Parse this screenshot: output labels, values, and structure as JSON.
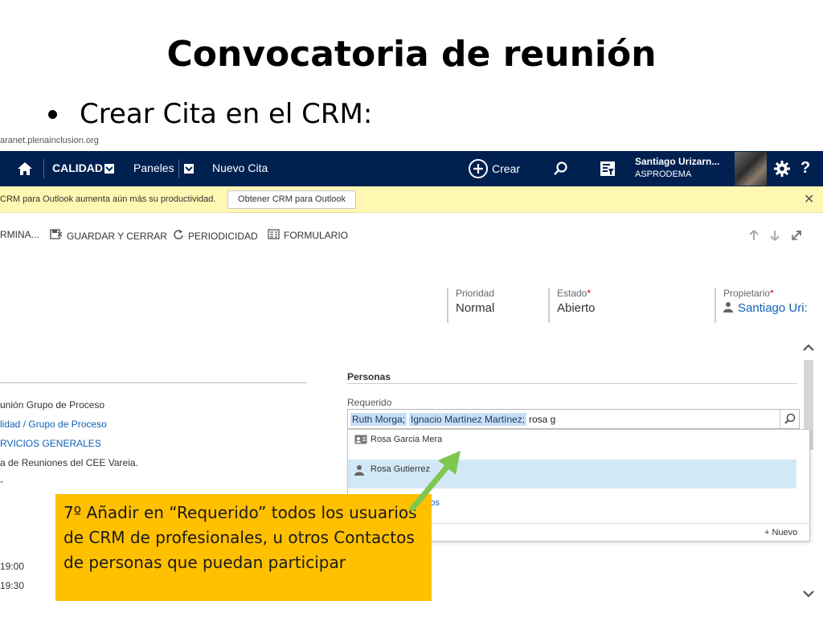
{
  "slide": {
    "title": "Convocatoria de reunión",
    "bullet": "Crear Cita en el CRM:"
  },
  "browser": {
    "url_fragment": "aranet.plenainclusion.org"
  },
  "topbar": {
    "home_icon": "home-icon",
    "area_label": "CALIDAD",
    "panels_label": "Paneles",
    "page_label": "Nuevo Cita",
    "create_label": "Crear",
    "user_name": "Santiago Urizarn...",
    "user_org": "ASPRODEMA",
    "help_label": "?",
    "colors": {
      "bar": "#002050",
      "text": "#ffffff"
    }
  },
  "notice": {
    "text": "CRM para Outlook aumenta aún más su productividad.",
    "button_label": "Obtener CRM para Outlook",
    "close_label": "✕",
    "colors": {
      "background": "#fff8b3"
    }
  },
  "commands": {
    "finish_label": "RMINA...",
    "save_close_label": "GUARDAR Y CERRAR",
    "recurrence_label": "PERIODICIDAD",
    "form_label": "FORMULARIO"
  },
  "header_fields": {
    "priority": {
      "label": "Prioridad",
      "value": "Normal"
    },
    "status": {
      "label": "Estado",
      "required_mark": "*",
      "value": "Abierto"
    },
    "owner": {
      "label": "Propietario",
      "required_mark": "*",
      "value": "Santiago Uri:"
    }
  },
  "left_fields": {
    "subject": "unión Grupo de Proceso",
    "regarding": "lidad / Grupo de Proceso",
    "service": "RVICIOS GENERALES",
    "location": "a de Reuniones del CEE Vareia.",
    "dash": "-",
    "start_time": "19:00",
    "end_time": "19:30"
  },
  "personas": {
    "section_title": "Personas",
    "required_label": "Requerido",
    "tokens": [
      "Ruth Morga;",
      "Ignacio Martínez Martínez;"
    ],
    "typed_text": "rosa g",
    "results": [
      {
        "name": "Rosa Garcia Mera",
        "icon": "contact-card-icon"
      },
      {
        "name": "Rosa Gutierrez",
        "icon": "user-icon"
      }
    ],
    "more_link": "stros",
    "new_label": "Nuevo",
    "colors": {
      "token_bg": "#c9dff5",
      "selected_bg": "#d3e8f7",
      "link": "#1160b7"
    }
  },
  "callout": {
    "text": "7º Añadir en “Requerido” todos los usuarios de CRM de profesionales, u otros Contactos de personas que puedan participar",
    "colors": {
      "background": "#ffc000",
      "arrow": "#7ec850"
    }
  }
}
